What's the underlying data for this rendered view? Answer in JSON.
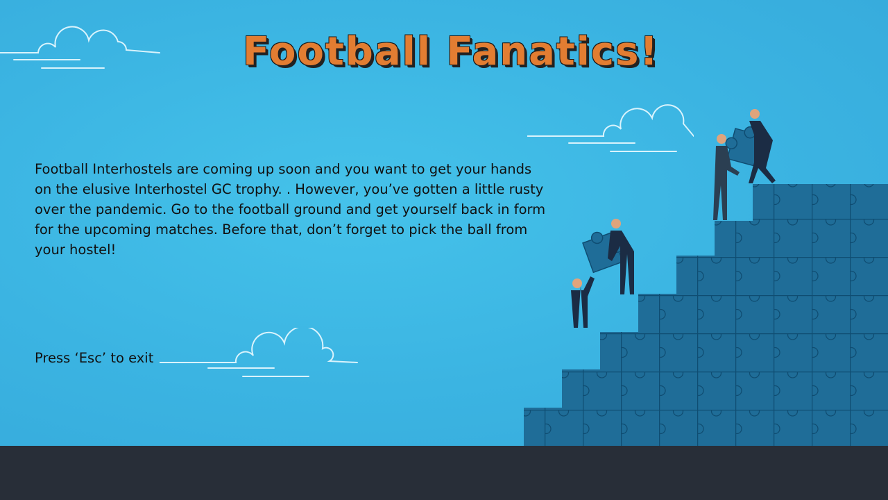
{
  "game": {
    "title": "Football Fanatics!",
    "story": "Football Interhostels are coming up soon and you want to get your hands on the elusive Interhostel GC trophy. . However, you’ve gotten a little rusty over the pandemic. Go to the football ground and get yourself back in form for the upcoming matches. Before that, don’t forget to pick the ball from your hostel!",
    "exit_hint": "Press ‘Esc’ to exit"
  },
  "colors": {
    "sky": "#3bb4e2",
    "title": "#e27d32",
    "puzzle": "#1f6d98",
    "ground": "#282e38"
  },
  "illustration": {
    "name": "businessmen-building-puzzle-staircase",
    "icons": [
      "cloud-icon",
      "puzzle-piece-icon",
      "businessman-icon"
    ]
  }
}
